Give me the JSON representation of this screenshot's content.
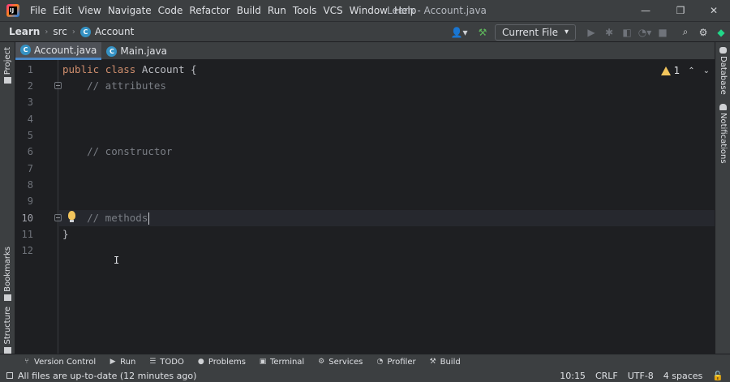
{
  "window": {
    "title": "Learn - Account.java",
    "minimize": "—",
    "maximize": "❐",
    "close": "✕"
  },
  "menu": [
    "File",
    "Edit",
    "View",
    "Navigate",
    "Code",
    "Refactor",
    "Build",
    "Run",
    "Tools",
    "VCS",
    "Window",
    "Help"
  ],
  "breadcrumb": {
    "project": "Learn",
    "folder": "src",
    "class": "Account"
  },
  "toolbar": {
    "run_config": "Current File",
    "run_config_arrow": "▾"
  },
  "tabs": [
    {
      "label": "Account.java",
      "active": true
    },
    {
      "label": "Main.java",
      "active": false
    }
  ],
  "editor": {
    "lines": [
      {
        "num": "1"
      },
      {
        "num": "2"
      },
      {
        "num": "3"
      },
      {
        "num": "4"
      },
      {
        "num": "5"
      },
      {
        "num": "6"
      },
      {
        "num": "7"
      },
      {
        "num": "8"
      },
      {
        "num": "9"
      },
      {
        "num": "10"
      },
      {
        "num": "11"
      },
      {
        "num": "12"
      }
    ],
    "code": {
      "l1_kw1": "public",
      "l1_kw2": "class",
      "l1_rest": " Account {",
      "l2": "    // attributes",
      "l6": "    // constructor",
      "l10": "    // methods",
      "l11": "}"
    },
    "inspection": {
      "warnings": "1",
      "up": "⌃",
      "down": "⌄"
    }
  },
  "left_tools": {
    "project": "Project",
    "bookmarks": "Bookmarks",
    "structure": "Structure"
  },
  "right_tools": {
    "database": "Database",
    "notifications": "Notifications"
  },
  "bottom_tools": [
    {
      "label": "Version Control",
      "icon": "⑂"
    },
    {
      "label": "Run",
      "icon": "▶"
    },
    {
      "label": "TODO",
      "icon": "☰"
    },
    {
      "label": "Problems",
      "icon": "●"
    },
    {
      "label": "Terminal",
      "icon": "▣"
    },
    {
      "label": "Services",
      "icon": "⚙"
    },
    {
      "label": "Profiler",
      "icon": "◔"
    },
    {
      "label": "Build",
      "icon": "⚒"
    }
  ],
  "status": {
    "message": "All files are up-to-date (12 minutes ago)",
    "position": "10:15",
    "line_sep": "CRLF",
    "encoding": "UTF-8",
    "indent": "4 spaces"
  },
  "colors": {
    "accent": "#4a88c7",
    "keyword": "#cf8e6d",
    "comment": "#7a7e85",
    "warning": "#f2c55c",
    "class_icon": "#3592c4"
  }
}
